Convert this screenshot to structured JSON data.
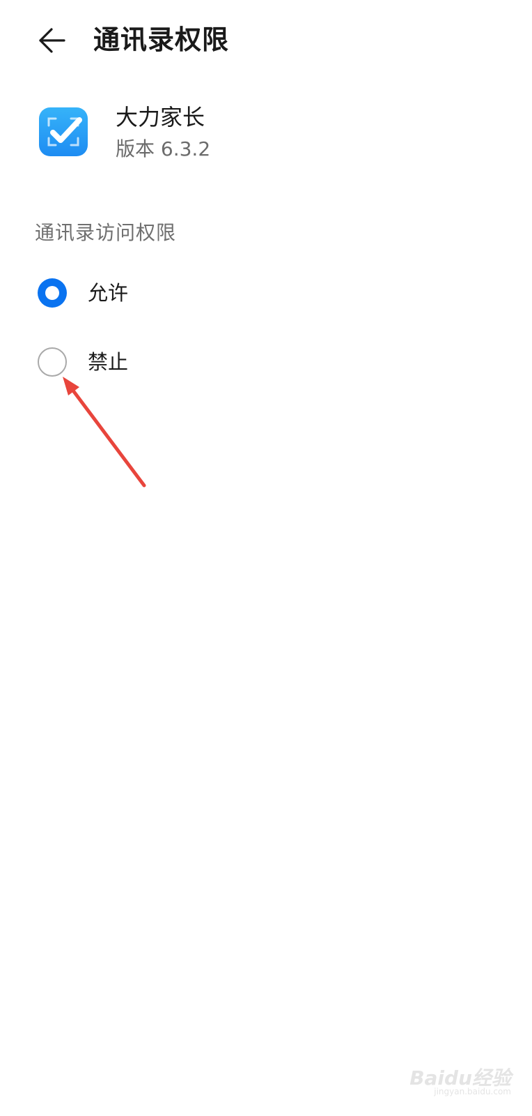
{
  "header": {
    "title": "通讯录权限",
    "back_icon": "arrow-left-icon"
  },
  "app": {
    "name": "大力家长",
    "version": "版本 6.3.2",
    "icon": "checkmark-scan-icon",
    "icon_color": "#1e8cf2"
  },
  "permission": {
    "section_label": "通讯录访问权限",
    "options": [
      {
        "label": "允许",
        "selected": true
      },
      {
        "label": "禁止",
        "selected": false
      }
    ],
    "accent_color": "#0a73f0"
  },
  "annotation": {
    "arrow_color": "#e8453c",
    "target": "禁止"
  },
  "watermark": {
    "text": "Baidu经验",
    "sub": "jingyan.baidu.com"
  }
}
